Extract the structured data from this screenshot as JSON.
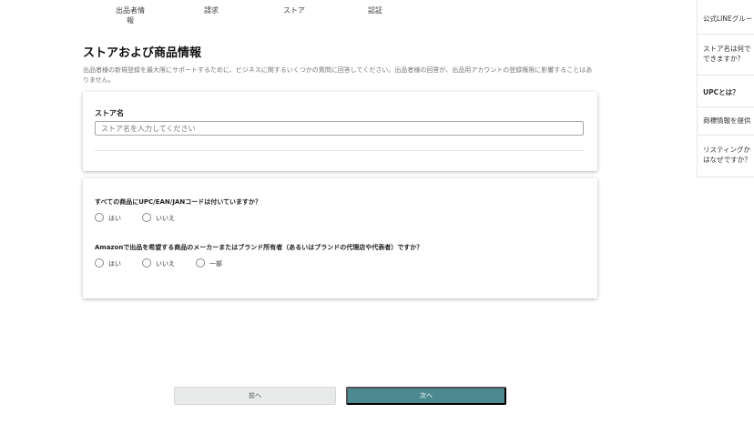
{
  "stepper": {
    "steps": [
      {
        "label": "出品者情\n報"
      },
      {
        "label": "請求"
      },
      {
        "label": "ストア"
      },
      {
        "label": "認証"
      }
    ]
  },
  "page": {
    "title": "ストアおよび商品情報",
    "subtitle": "出品者様の新規登録を最大限にサポートするために、ビジネスに関するいくつかの質問に回答してください。出品者様の回答が、出品用アカウントの登録権限に影響することはありません。"
  },
  "store_card": {
    "label": "ストア名",
    "placeholder": "ストア名を入力してください",
    "value": ""
  },
  "questions_card": {
    "q1": {
      "text": "すべての商品にUPC/EAN/JANコードは付いていますか？",
      "options": [
        "はい",
        "いいえ"
      ]
    },
    "q2": {
      "text": "Amazonで出品を希望する商品のメーカーまたはブランド所有者（あるいはブランドの代理店や代表者）ですか？",
      "options": [
        "はい",
        "いいえ",
        "一部"
      ]
    }
  },
  "footer": {
    "prev_label": "前へ",
    "next_label": "次へ"
  },
  "sidebar": {
    "items": [
      {
        "label": "公式LINEグルー"
      },
      {
        "label": "ストア名は何で\nできますか？"
      },
      {
        "label": "UPCとは？"
      },
      {
        "label": "商標情報を提供"
      },
      {
        "label": "リスティングか\nはなぜですか？"
      }
    ]
  },
  "colors": {
    "primary_button": "#4b8a91",
    "secondary_button": "#e8eaea"
  }
}
